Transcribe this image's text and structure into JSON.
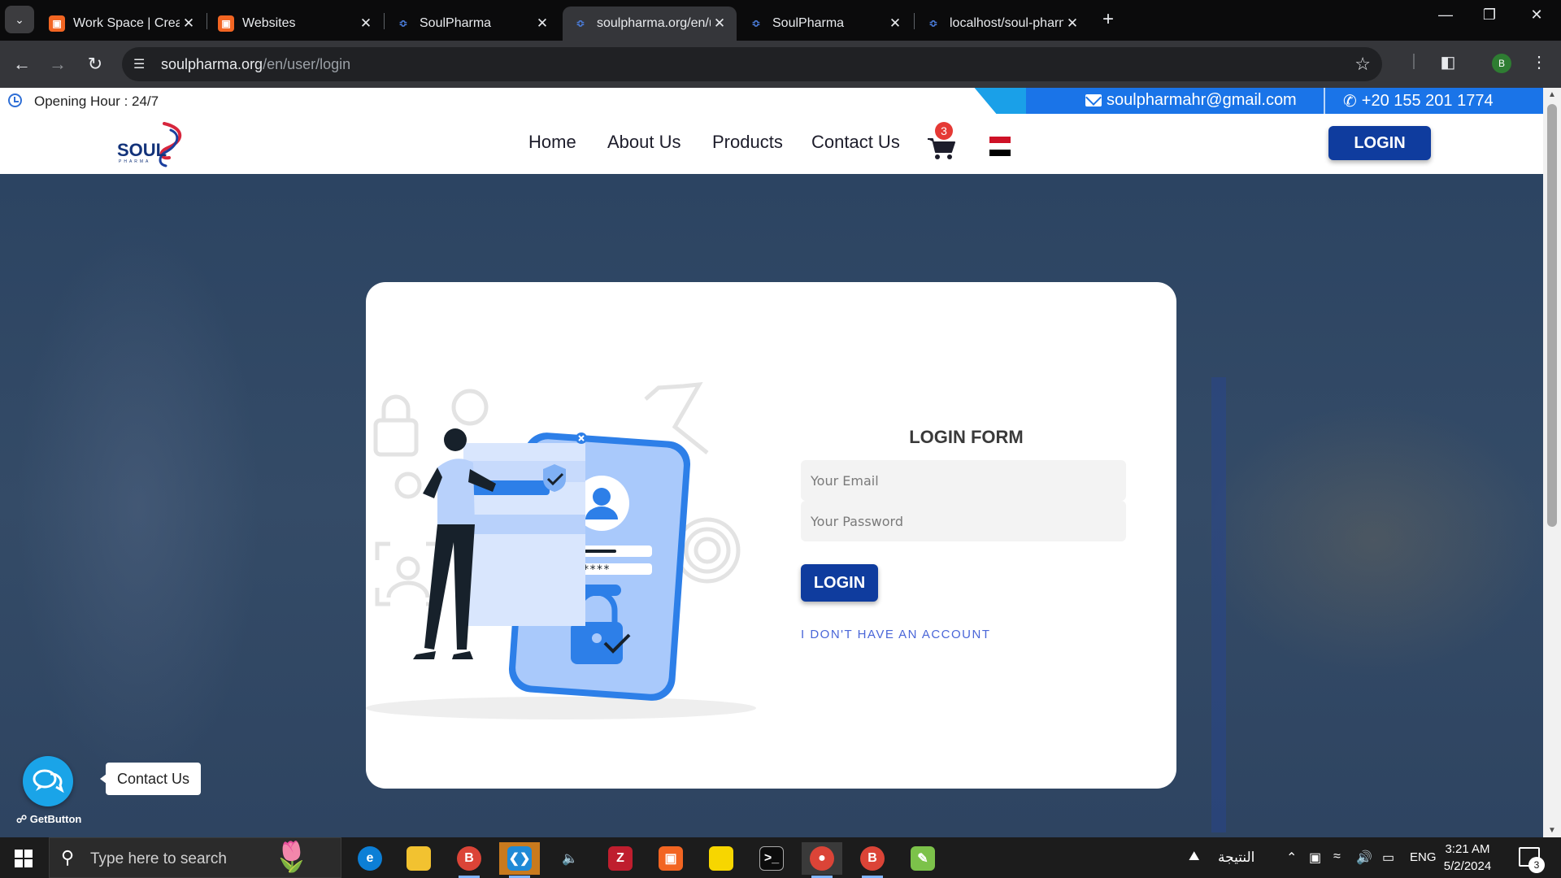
{
  "browser": {
    "tabs": [
      {
        "title": "Work Space | Created By El",
        "icon": "orange-app-icon",
        "active": false
      },
      {
        "title": "Websites",
        "icon": "orange-app-icon",
        "active": false
      },
      {
        "title": "SoulPharma",
        "icon": "soulpharma-favicon",
        "active": false
      },
      {
        "title": "soulpharma.org/en/user/lo",
        "icon": "soulpharma-favicon",
        "active": true
      },
      {
        "title": "SoulPharma",
        "icon": "soulpharma-favicon",
        "active": false
      },
      {
        "title": "localhost/soul-pharma-ne",
        "icon": "soulpharma-favicon",
        "active": false
      }
    ],
    "url_host": "soulpharma.org",
    "url_path": "/en/user/login",
    "profile_initial": "B"
  },
  "topbar": {
    "opening_hours": "Opening Hour : 24/7",
    "email": "soulpharmahr@gmail.com",
    "phone": "+20 155 201 1774",
    "accent_color": "#1a74e8"
  },
  "header": {
    "logo_text": "SOUL",
    "logo_sub": "PHARMA",
    "nav": [
      "Home",
      "About Us",
      "Products",
      "Contact Us"
    ],
    "cart_count": "3",
    "login_label": "LOGIN"
  },
  "login_form": {
    "title": "LOGIN FORM",
    "email_placeholder": "Your Email",
    "password_placeholder": "Your Password",
    "submit_label": "LOGIN",
    "no_account_link": "I DON'T HAVE AN ACCOUNT",
    "button_color": "#0f3c9e"
  },
  "illustration": {
    "password_mask": "*****"
  },
  "getbutton": {
    "label": "Contact Us",
    "brand": "GetButton"
  },
  "taskbar": {
    "search_hint": "Type here to search",
    "weather_text": "النتيجة",
    "language": "ENG",
    "time": "3:21 AM",
    "date": "5/2/2024",
    "notification_count": "3"
  }
}
